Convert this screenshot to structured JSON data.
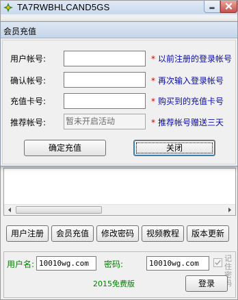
{
  "main_window": {
    "title": "TA7RWBHLCAND5GS",
    "buttons": [
      "用户注册",
      "会员充值",
      "修改密码",
      "视频教程",
      "版本更新"
    ],
    "login": {
      "username_label": "用户名:",
      "username_value": "10010wg.com",
      "password_label": "密码:",
      "password_value": "10010wg.com",
      "remember_label": "记住密码",
      "edition_label": "2015免费版",
      "login_button": "登录"
    }
  },
  "dialog": {
    "title": "会员充值",
    "fields": [
      {
        "label": "用户帐号:",
        "value": "",
        "hint": "以前注册的登录帐号"
      },
      {
        "label": "确认帐号:",
        "value": "",
        "hint": "再次输入登录帐号"
      },
      {
        "label": "充值卡号:",
        "value": "",
        "hint": "购买到的充值卡号"
      },
      {
        "label": "推荐帐号:",
        "value": "暂未开启活动",
        "hint": "推荐帐号赠送三天"
      }
    ],
    "required_mark": "*",
    "confirm_button": "确定充值",
    "close_button": "关闭"
  },
  "colors": {
    "hint_text": "#0a0aa6",
    "required_mark": "#d00000",
    "login_labels": "#008000"
  },
  "icons": [
    "app-icon",
    "minimize-icon",
    "close-icon",
    "scroll-left-icon",
    "scroll-right-icon"
  ]
}
